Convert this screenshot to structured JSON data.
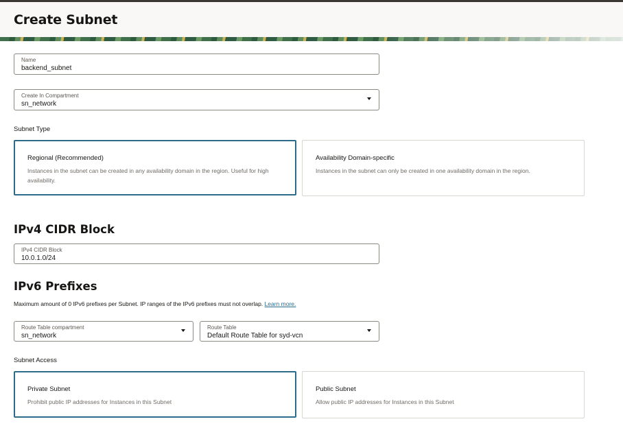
{
  "page": {
    "title": "Create Subnet"
  },
  "name_field": {
    "label": "Name",
    "value": "backend_subnet"
  },
  "compartment_field": {
    "label": "Create In Compartment",
    "value": "sn_network"
  },
  "subnet_type": {
    "label": "Subnet Type",
    "options": [
      {
        "title": "Regional (Recommended)",
        "description": "Instances in the subnet can be created in any availability domain in the region. Useful for high availability.",
        "selected": true
      },
      {
        "title": "Availability Domain-specific",
        "description": "Instances in the subnet can only be created in one availability domain in the region.",
        "selected": false
      }
    ]
  },
  "ipv4": {
    "heading": "IPv4 CIDR Block",
    "field_label": "IPv4 CIDR Block",
    "value": "10.0.1.0/24"
  },
  "ipv6": {
    "heading": "IPv6 Prefixes",
    "note": "Maximum amount of 0 IPv6 prefixes per Subnet. IP ranges of the IPv6 prefixes must not overlap.",
    "learn_more": "Learn more."
  },
  "route_table_compartment": {
    "label": "Route Table compartment",
    "value": "sn_network"
  },
  "route_table": {
    "label": "Route Table",
    "value": "Default Route Table for syd-vcn"
  },
  "subnet_access": {
    "label": "Subnet Access",
    "options": [
      {
        "title": "Private Subnet",
        "description": "Prohibit public IP addresses for Instances in this Subnet",
        "selected": true
      },
      {
        "title": "Public Subnet",
        "description": "Allow public IP addresses for Instances in this Subnet",
        "selected": false
      }
    ]
  },
  "colors": {
    "accent": "#2c6b8a",
    "field_border": "#8b8781",
    "card_border": "#d9d5cf"
  }
}
